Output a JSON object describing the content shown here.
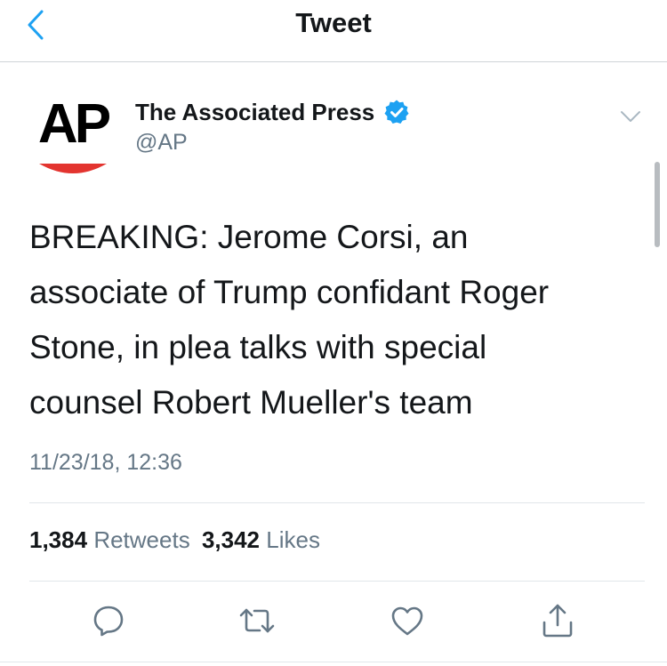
{
  "navbar": {
    "title": "Tweet",
    "back_icon": "chevron-left-icon"
  },
  "author": {
    "name": "The Associated Press",
    "handle": "@AP",
    "verified": true,
    "avatar_text": "AP"
  },
  "tweet": {
    "lines": [
      "BREAKING: Jerome Corsi, an",
      "associate of Trump confidant Roger",
      "Stone, in plea talks with special",
      "counsel Robert Mueller's team"
    ],
    "timestamp": "11/23/18, 12:36"
  },
  "stats": {
    "retweets_count": "1,384",
    "retweets_label": "Retweets",
    "likes_count": "3,342",
    "likes_label": "Likes"
  },
  "actions": [
    "reply-icon",
    "retweet-icon",
    "like-icon",
    "share-icon"
  ],
  "colors": {
    "accent": "#1da1f2",
    "text": "#14171a",
    "secondary_text": "#657786",
    "ap_red": "#e3342f",
    "icon": "#657786"
  }
}
